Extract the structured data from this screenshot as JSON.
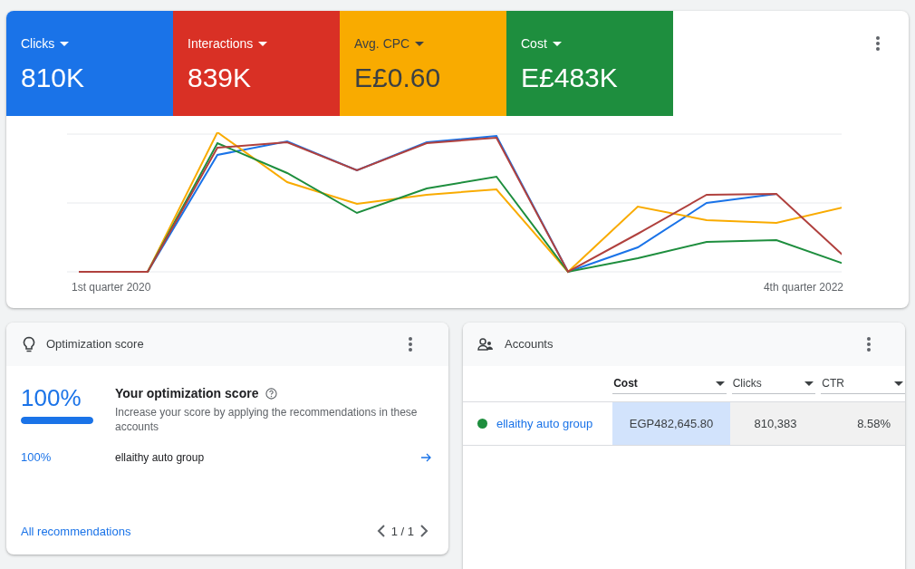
{
  "metrics": [
    {
      "label": "Clicks",
      "value": "810K",
      "color": "#1a73e8",
      "selected": true
    },
    {
      "label": "Interactions",
      "value": "839K",
      "color": "#d93025",
      "selected": true
    },
    {
      "label": "Avg. CPC",
      "value": "E£0.60",
      "color": "#f9ab00",
      "selected": true
    },
    {
      "label": "Cost",
      "value": "E£483K",
      "color": "#1e8e3e",
      "selected": true
    }
  ],
  "chart": {
    "x_start": "1st quarter 2020",
    "x_end": "4th quarter 2022"
  },
  "optimization": {
    "title": "Optimization score",
    "score": "100%",
    "level": 1,
    "heading": "Your optimization score",
    "description": "Increase your score by applying the recommendations in these accounts",
    "accounts": [
      {
        "score": "100%",
        "name": "ellaithy auto group"
      }
    ],
    "link": "All recommendations",
    "pager": "1 / 1"
  },
  "accounts": {
    "title": "Accounts",
    "columns": [
      {
        "label": "Cost",
        "sorted": true
      },
      {
        "label": "Clicks",
        "sorted": false
      },
      {
        "label": "CTR",
        "sorted": false
      }
    ],
    "rows": [
      {
        "name": "ellaithy auto group",
        "color": "#1e8e3e",
        "cells": [
          "EGP482,645.80",
          "810,383",
          "8.58%"
        ]
      }
    ]
  }
}
